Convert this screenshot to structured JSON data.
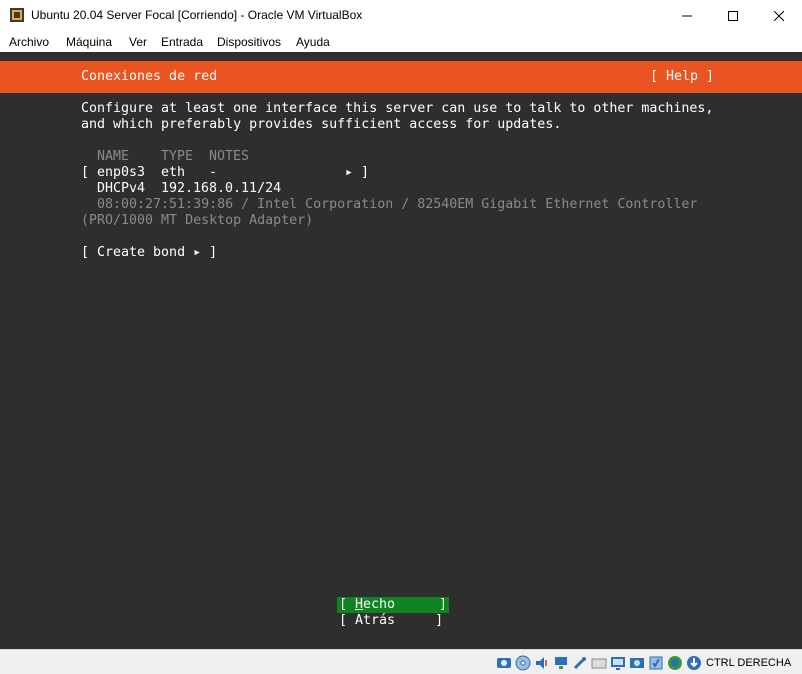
{
  "window": {
    "title": "Ubuntu 20.04 Server Focal [Corriendo] - Oracle VM VirtualBox",
    "controls": [
      "minimize",
      "maximize",
      "close"
    ]
  },
  "menubar": {
    "items": [
      "Archivo",
      "Máquina",
      "Ver",
      "Entrada",
      "Dispositivos",
      "Ayuda"
    ]
  },
  "installer": {
    "header_title": "Conexiones de red",
    "help_button": "[ Help ]",
    "description_line1": "Configure at least one interface this server can use to talk to other machines,",
    "description_line2": "and which preferably provides sufficient access for updates.",
    "table": {
      "col_name": "NAME",
      "col_type": "TYPE",
      "col_notes": "NOTES",
      "row": {
        "open_bracket": "[",
        "name": "enp0s3",
        "type": "eth",
        "notes": "-",
        "arrow": "▸",
        "close_bracket": "]",
        "dhcp_label": "DHCPv4",
        "address": "192.168.0.11/24",
        "hw_line1": "08:00:27:51:39:86 / Intel Corporation / 82540EM Gigabit Ethernet Controller",
        "hw_line2": "(PRO/1000 MT Desktop Adapter)"
      }
    },
    "create_bond": "[ Create bond ▸ ]",
    "buttons": {
      "done_open": "[ ",
      "done_hotkey": "H",
      "done_rest": "echo",
      "done_close": "]",
      "back": "[ Atrás     ]"
    }
  },
  "statusbar": {
    "host_key": "CTRL DERECHA",
    "icons": [
      "hard-disk-icon",
      "optical-disk-icon",
      "audio-icon",
      "network-icon",
      "usb-icon",
      "shared-folder-icon",
      "display-icon",
      "recording-icon",
      "virtualization-icon",
      "mouse-integration-icon",
      "download-icon"
    ]
  },
  "colors": {
    "ubuntu_orange": "#e95420",
    "terminal_bg": "#2e2e2e",
    "selected_button": "#0e8420"
  }
}
